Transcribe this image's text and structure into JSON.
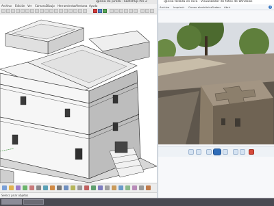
{
  "sketchup": {
    "title": "iglesia de pirata - SketchUp Pro 2",
    "menu": [
      "Archivo",
      "Edición",
      "Ver",
      "Cámara",
      "Dibujo",
      "Herramientas",
      "Ventana",
      "Ayuda"
    ],
    "status_text": "Selecc pnar objetos"
  },
  "photo_viewer": {
    "title": "iglesia tallada en roca - Visualizador de fotos de Windows",
    "menu": [
      "Archivo",
      "Imprimir",
      "Correo electrónico",
      "Grabar",
      "Abrir"
    ],
    "help_label": "?"
  },
  "colors": {
    "accent_red": "#d33b3b",
    "accent_blue": "#2f6db8"
  }
}
